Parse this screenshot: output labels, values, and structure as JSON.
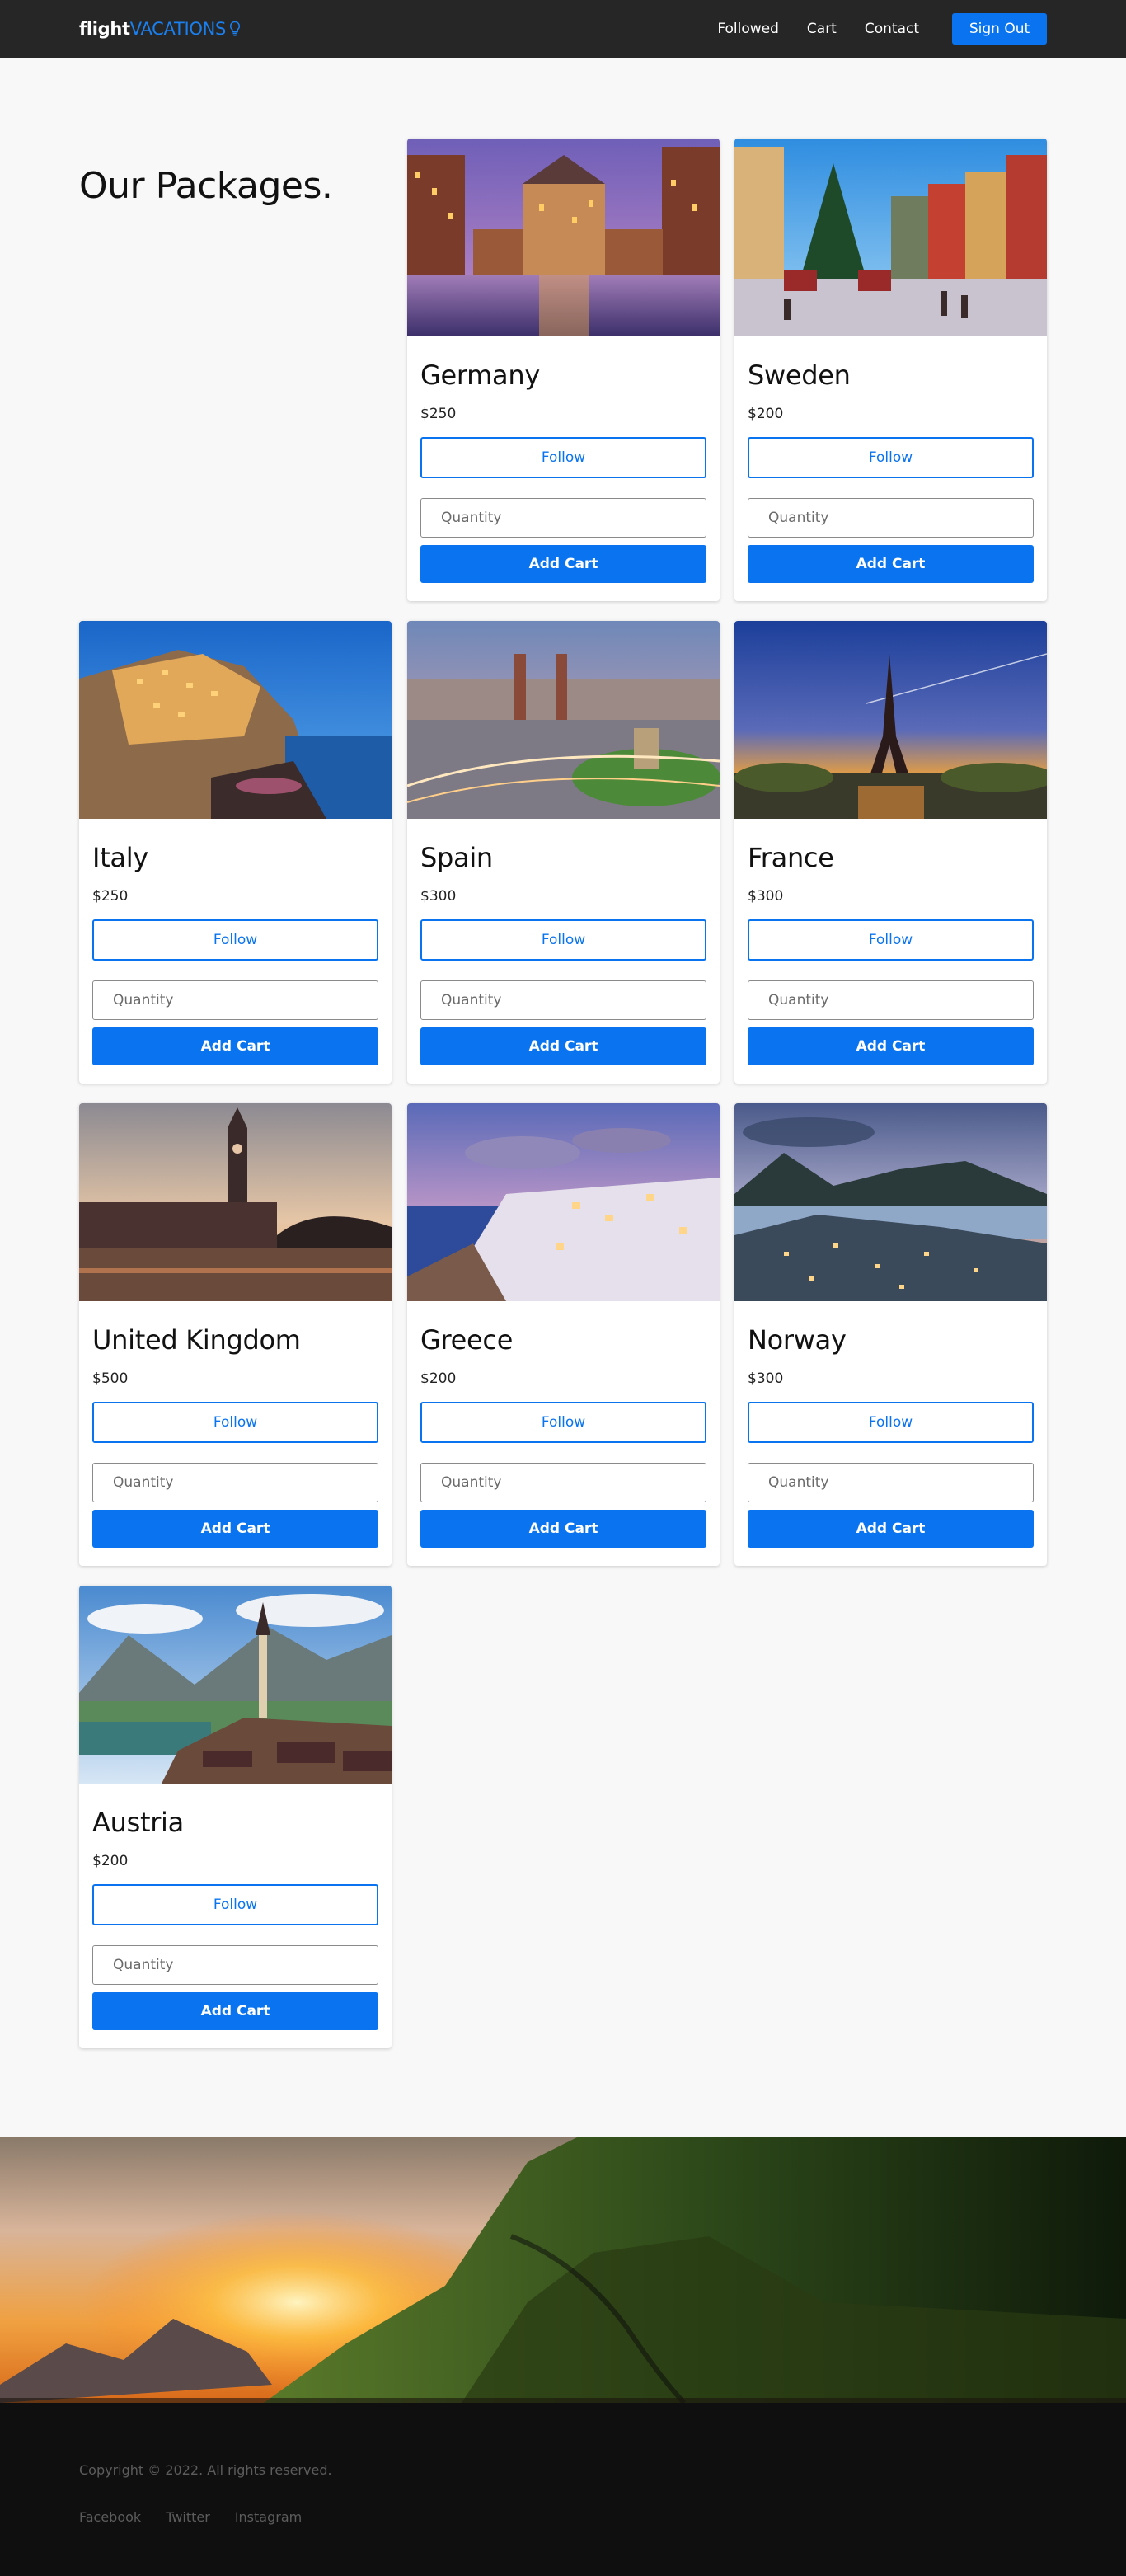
{
  "navbar": {
    "brand_part1": "flight",
    "brand_part2": "VACATIONS",
    "brand_icon": "lightbulb-icon",
    "links": [
      "Followed",
      "Cart",
      "Contact"
    ],
    "signout_label": "Sign Out",
    "accent_color": "#0a74f0"
  },
  "main": {
    "title": "Our Packages."
  },
  "packages": [
    {
      "name": "Germany",
      "price": "$250",
      "follow_label": "Follow",
      "qty_placeholder": "Quantity",
      "add_label": "Add Cart",
      "image": "hamburg-canal-photo"
    },
    {
      "name": "Sweden",
      "price": "$200",
      "follow_label": "Follow",
      "qty_placeholder": "Quantity",
      "add_label": "Add Cart",
      "image": "stockholm-christmas-market-photo"
    },
    {
      "name": "Italy",
      "price": "$250",
      "follow_label": "Follow",
      "qty_placeholder": "Quantity",
      "add_label": "Add Cart",
      "image": "manarola-cliff-village-photo"
    },
    {
      "name": "Spain",
      "price": "$300",
      "follow_label": "Follow",
      "qty_placeholder": "Quantity",
      "add_label": "Add Cart",
      "image": "barcelona-plaza-photo"
    },
    {
      "name": "France",
      "price": "$300",
      "follow_label": "Follow",
      "qty_placeholder": "Quantity",
      "add_label": "Add Cart",
      "image": "eiffel-tower-sunset-photo"
    },
    {
      "name": "United Kingdom",
      "price": "$500",
      "follow_label": "Follow",
      "qty_placeholder": "Quantity",
      "add_label": "Add Cart",
      "image": "big-ben-thames-photo"
    },
    {
      "name": "Greece",
      "price": "$200",
      "follow_label": "Follow",
      "qty_placeholder": "Quantity",
      "add_label": "Add Cart",
      "image": "santorini-village-photo"
    },
    {
      "name": "Norway",
      "price": "$300",
      "follow_label": "Follow",
      "qty_placeholder": "Quantity",
      "add_label": "Add Cart",
      "image": "alesund-town-photo"
    },
    {
      "name": "Austria",
      "price": "$200",
      "follow_label": "Follow",
      "qty_placeholder": "Quantity",
      "add_label": "Add Cart",
      "image": "hallstatt-lake-photo"
    }
  ],
  "hero": {
    "image": "mountain-sunset-photo"
  },
  "footer": {
    "copyright": "Copyright © 2022. All rights reserved.",
    "social": [
      "Facebook",
      "Twitter",
      "Instagram"
    ]
  }
}
